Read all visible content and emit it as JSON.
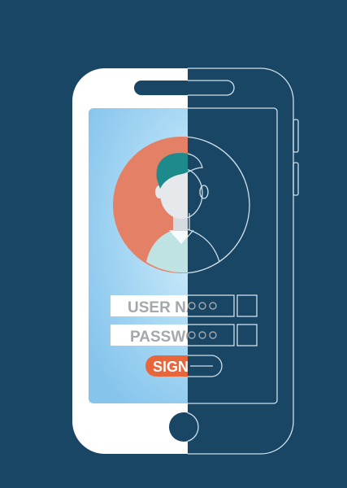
{
  "illustration": {
    "username_label": "USER NA",
    "password_label": "PASSWO",
    "sign_label": "SIGN",
    "colors": {
      "background": "#184664",
      "phone_body": "#ffffff",
      "screen_light": "#cfe9f8",
      "screen_blue": "#8fcaf0",
      "avatar_circle": "#e48066",
      "hair": "#1f8a8c",
      "skin": "#e6e9ec",
      "shirt": "#bfe3e3",
      "input_fill": "#ffffff",
      "label_text": "#a3a8ad",
      "sign_button": "#e8663a",
      "outline": "#cfe1ec"
    },
    "icons": [
      "avatar-icon",
      "home-button-icon",
      "speaker-slot-icon"
    ]
  }
}
